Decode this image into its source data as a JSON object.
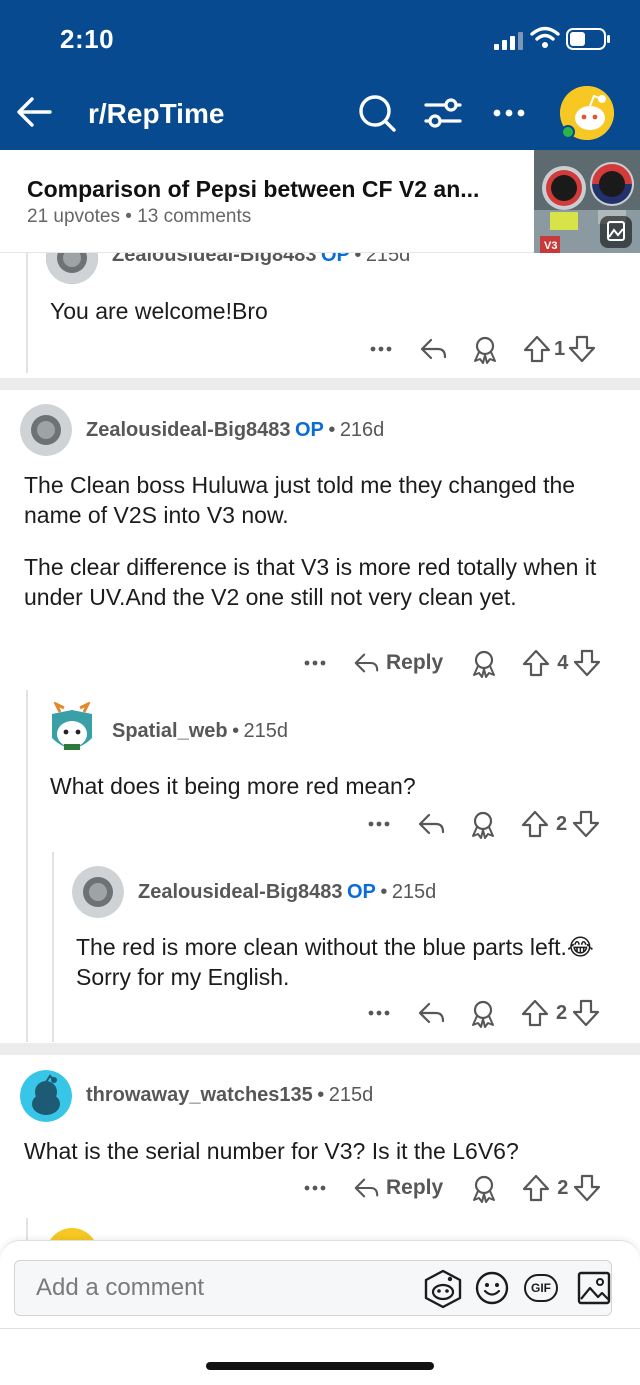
{
  "status": {
    "time": "2:10"
  },
  "header": {
    "subreddit": "r/RepTime"
  },
  "post": {
    "title": "Comparison of Pepsi between CF V2 an...",
    "upvotes": "21 upvotes",
    "bullet": "•",
    "comments": "13 comments",
    "thumb_label": "V3"
  },
  "comments": [
    {
      "user": "Zealousideal-Big8483",
      "op": "OP",
      "age": "215d",
      "body": "You are welcome!Bro",
      "votes": "1"
    },
    {
      "user": "Zealousideal-Big8483",
      "op": "OP",
      "age": "216d",
      "body1": "The Clean boss Huluwa just told me they changed the name of V2S into V3 now.",
      "body2": "The clear difference is that V3 is more red totally when it under UV.And the V2 one still not very clean yet.",
      "reply": "Reply",
      "votes": "4"
    },
    {
      "user": "Spatial_web",
      "age": "215d",
      "body": "What does it being more red mean?",
      "votes": "2"
    },
    {
      "user": "Zealousideal-Big8483",
      "op": "OP",
      "age": "215d",
      "body": "The red is more clean without the blue parts left.😂Sorry for my English.",
      "votes": "2"
    },
    {
      "user": "throwaway_watches135",
      "age": "215d",
      "body": "What is the serial number for V3? Is it the L6V6?",
      "reply": "Reply",
      "votes": "2"
    }
  ],
  "composer": {
    "placeholder": "Add a comment",
    "gif": "GIF"
  },
  "icons": [
    "back-arrow-icon",
    "search-icon",
    "filter-icon",
    "more-icon",
    "reply-icon",
    "award-icon",
    "upvote-icon",
    "downvote-icon",
    "snoo-icon",
    "emoji-icon",
    "gif-icon",
    "image-icon"
  ]
}
